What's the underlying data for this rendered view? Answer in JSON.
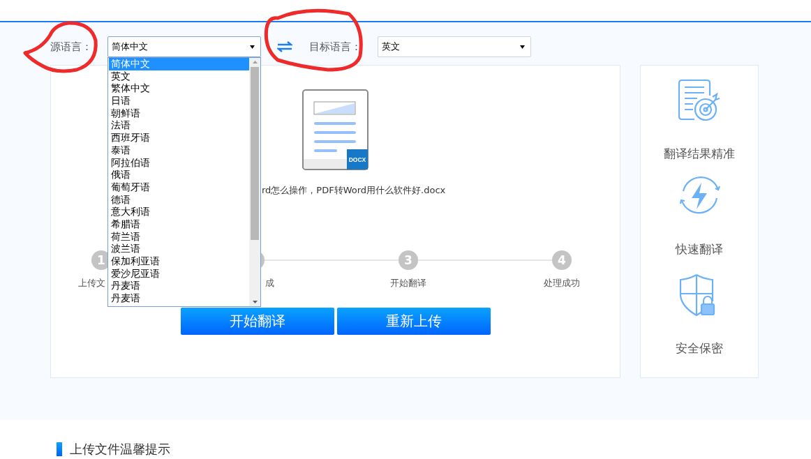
{
  "source_language": {
    "label": "源语言：",
    "value": "简体中文",
    "options": [
      {
        "label": "简体中文",
        "selected": true
      },
      {
        "label": "英文",
        "selected": false
      },
      {
        "label": "繁体中文",
        "selected": false
      },
      {
        "label": "日语",
        "selected": false
      },
      {
        "label": "朝鲜语",
        "selected": false
      },
      {
        "label": "法语",
        "selected": false
      },
      {
        "label": "西班牙语",
        "selected": false
      },
      {
        "label": "泰语",
        "selected": false
      },
      {
        "label": "阿拉伯语",
        "selected": false
      },
      {
        "label": "俄语",
        "selected": false
      },
      {
        "label": "葡萄牙语",
        "selected": false
      },
      {
        "label": "德语",
        "selected": false
      },
      {
        "label": "意大利语",
        "selected": false
      },
      {
        "label": "希腊语",
        "selected": false
      },
      {
        "label": "荷兰语",
        "selected": false
      },
      {
        "label": "波兰语",
        "selected": false
      },
      {
        "label": "保加利亚语",
        "selected": false
      },
      {
        "label": "爱沙尼亚语",
        "selected": false
      },
      {
        "label": "丹麦语",
        "selected": false
      },
      {
        "label": "丹麦语",
        "selected": false
      }
    ]
  },
  "target_language": {
    "label": "目标语言：",
    "value": "英文"
  },
  "file": {
    "badge": "DOCX",
    "name": "rd怎么操作，PDF转Word用什么软件好.docx"
  },
  "steps": [
    {
      "number": "1",
      "label": "上传文"
    },
    {
      "label": "成"
    },
    {
      "number": "3",
      "label": "开始翻译"
    },
    {
      "number": "4",
      "label": "处理成功"
    }
  ],
  "buttons": [
    "开始翻译",
    "重新上传"
  ],
  "features": [
    {
      "kind": "target",
      "label": "翻译结果精准"
    },
    {
      "kind": "speed",
      "label": "快速翻译"
    },
    {
      "kind": "shield",
      "label": "安全保密"
    }
  ],
  "tips_heading": "上传文件温馨提示"
}
